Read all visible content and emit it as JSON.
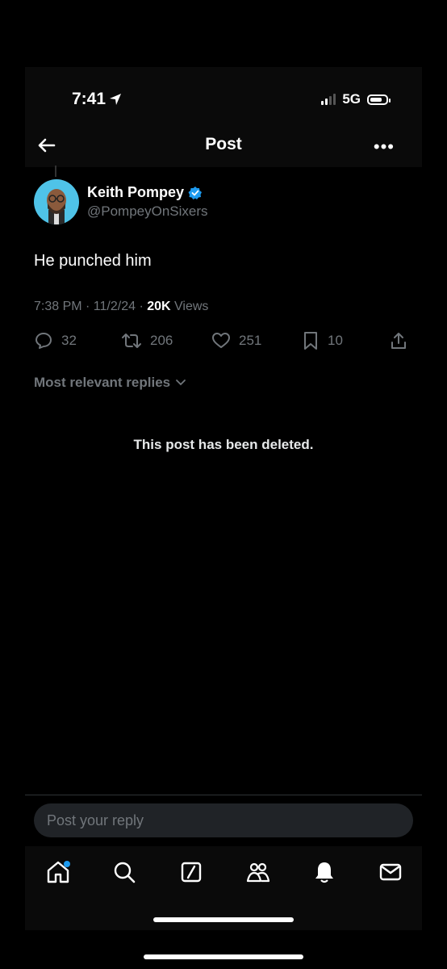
{
  "status_bar": {
    "time": "7:41",
    "network": "5G"
  },
  "header": {
    "title": "Post"
  },
  "post": {
    "author_name": "Keith Pompey",
    "author_handle": "@PompeyOnSixers",
    "text": "He punched him",
    "timestamp": "7:38 PM · 11/2/24 · ",
    "views_count": "20K",
    "views_label": " Views",
    "stats": {
      "replies": "32",
      "reposts": "206",
      "likes": "251",
      "bookmarks": "10"
    }
  },
  "replies": {
    "sort_label": "Most relevant replies",
    "deleted_notice": "This post has been deleted."
  },
  "composer": {
    "placeholder": "Post your reply"
  },
  "tabbar": {
    "items": [
      "home-icon",
      "search-icon",
      "grok-icon",
      "communities-icon",
      "notifications-icon",
      "messages-icon"
    ]
  },
  "colors": {
    "accent": "#1d9bf0",
    "muted": "#71767b",
    "background": "#000000"
  }
}
